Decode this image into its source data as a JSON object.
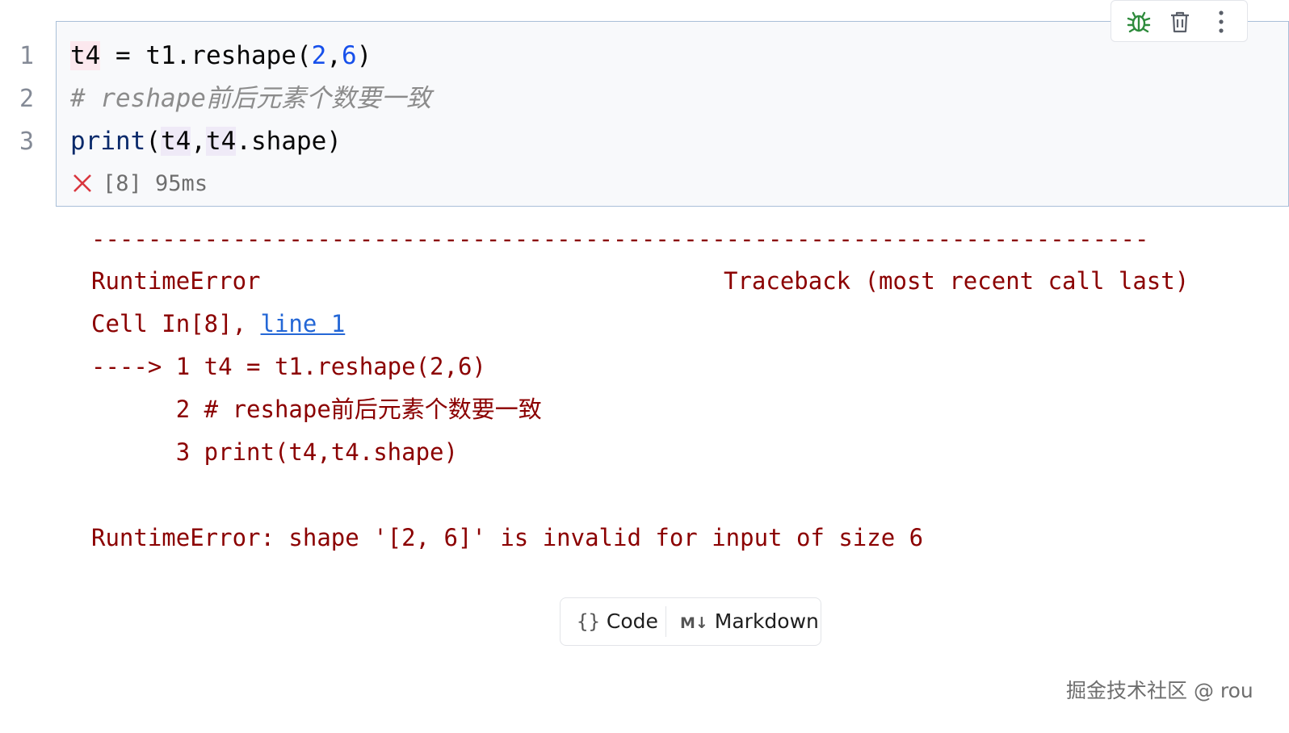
{
  "cell": {
    "line_numbers": [
      "1",
      "2",
      "3"
    ],
    "line1": {
      "var": "t4",
      "assign": " = t1.reshape(",
      "arg1": "2",
      "comma": ",",
      "arg2": "6",
      "close": ")"
    },
    "line2": {
      "comment": "# reshape前后元素个数要一致"
    },
    "line3": {
      "fn": "print",
      "open": "(",
      "arg_a": "t4",
      "comma": ",",
      "arg_b": "t4",
      "rest": ".shape)"
    },
    "status": {
      "exec_count": "[8]",
      "duration": "95ms"
    }
  },
  "toolbar": {
    "icons": [
      "bug-icon",
      "trash-icon",
      "more-vertical-icon"
    ]
  },
  "output": {
    "dashes": "---------------------------------------------------------------------------",
    "error_name": "RuntimeError",
    "traceback_header": "Traceback (most recent call last)",
    "cell_ref_prefix": "Cell In[8], ",
    "cell_ref_link": "line 1",
    "trace_line1": "----> 1 t4 = t1.reshape(2,6)",
    "trace_line2": "      2 # reshape前后元素个数要一致",
    "trace_line3": "      3 print(t4,t4.shape)",
    "error_message": "RuntimeError: shape '[2, 6]' is invalid for input of size 6"
  },
  "add_cell": {
    "code_label": "Code",
    "markdown_label": "Markdown"
  },
  "watermark": "掘金技术社区 @ rou",
  "colors": {
    "error_text": "#8b0000",
    "link": "#2467d6",
    "number": "#1750eb",
    "cell_border": "#a9bfd8"
  }
}
